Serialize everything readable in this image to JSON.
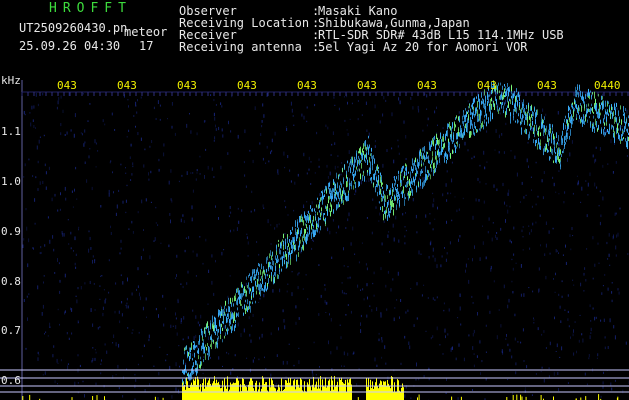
{
  "header": {
    "app_title": "HROFFT",
    "file_name": "UT2509260430.pn",
    "meteor_label": "meteor",
    "date_time": "25.09.26 04:30",
    "meteor_count": "17"
  },
  "metadata": [
    {
      "key": "Observer",
      "value": "Masaki Kano"
    },
    {
      "key": "Receiving Location",
      "value": "Shibukawa,Gunma,Japan"
    },
    {
      "key": "Receiver",
      "value": "RTL-SDR SDR# 43dB L15 114.1MHz USB"
    },
    {
      "key": "Receiving antenna",
      "value": "5el Yagi Az 20 for Aomori VOR"
    }
  ],
  "axis": {
    "unit": "kHz",
    "y_ticks": [
      "1.1",
      "1.0",
      "0.9",
      "0.8",
      "0.7",
      "0.6"
    ],
    "x_ticks": [
      "043",
      "043",
      "043",
      "043",
      "043",
      "043",
      "043",
      "043",
      "043",
      "0440"
    ]
  },
  "colors": {
    "background": "#000000",
    "noise": "#1a2a8c",
    "signal_core": "#3ab0ff",
    "signal_hot": "#7dff7d",
    "power_bar": "#ffff00",
    "tick_yellow": "#f0f000",
    "ref_line": "#c8c8ff"
  }
}
